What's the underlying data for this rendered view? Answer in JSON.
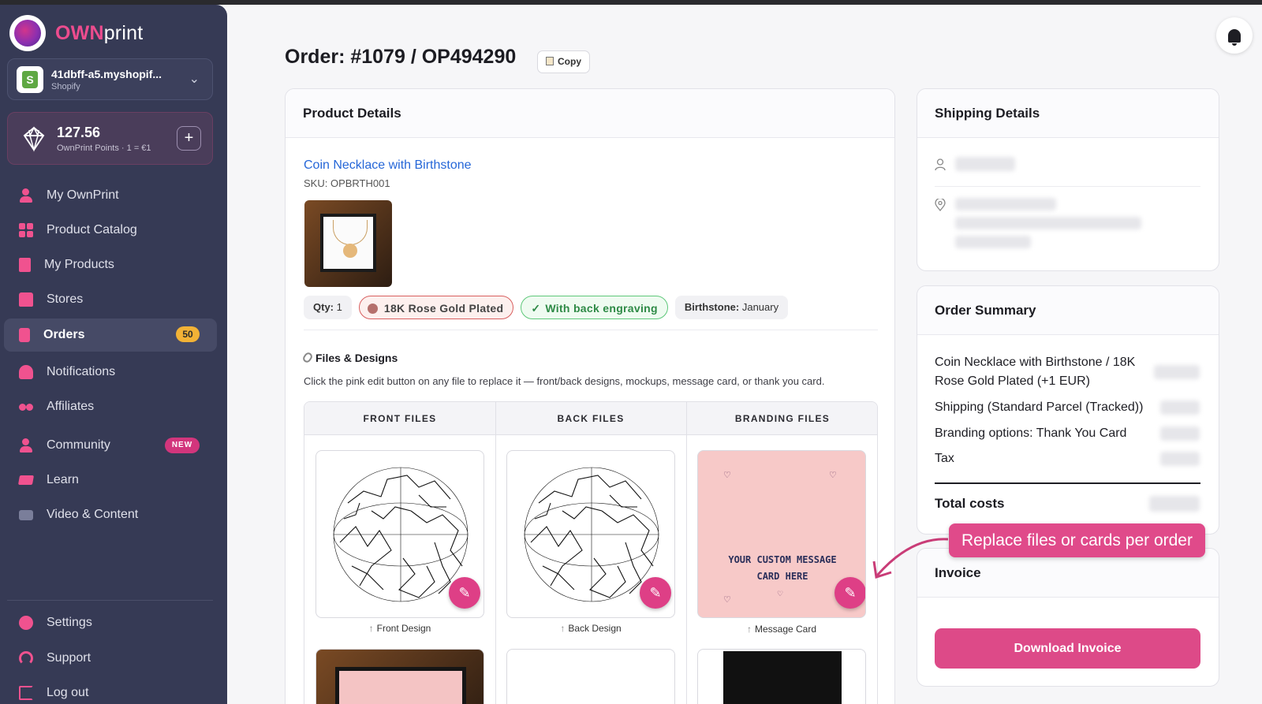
{
  "brand": {
    "own": "OWN",
    "print": "print"
  },
  "store": {
    "name": "41dbff-a5.myshopif...",
    "platform": "Shopify",
    "shop_icon_letter": "S"
  },
  "points": {
    "value": "127.56",
    "subtitle": "OwnPrint Points · 1 = €1",
    "add_label": "+"
  },
  "nav": {
    "my_ownprint": "My OwnPrint",
    "product_catalog": "Product Catalog",
    "my_products": "My Products",
    "stores": "Stores",
    "orders": "Orders",
    "orders_badge": "50",
    "notifications": "Notifications",
    "affiliates": "Affiliates",
    "community": "Community",
    "community_badge": "NEW",
    "learn": "Learn",
    "video_content": "Video & Content",
    "settings": "Settings",
    "support": "Support",
    "logout": "Log out"
  },
  "header": {
    "title": "Order: #1079 / OP494290",
    "copy_label": "Copy"
  },
  "product_details": {
    "heading": "Product Details",
    "product_name": "Coin Necklace with Birthstone",
    "sku": "SKU: OPBRTH001",
    "qty_label": "Qty:",
    "qty_value": "1",
    "material": "18K Rose Gold Plated",
    "engraving": "With back engraving",
    "birthstone_label": "Birthstone:",
    "birthstone_value": "January",
    "files_title": "Files & Designs",
    "files_desc": "Click the pink edit button on any file to replace it — front/back designs, mockups, message card, or thank you card.",
    "columns": [
      "FRONT FILES",
      "BACK FILES",
      "BRANDING FILES"
    ],
    "captions": {
      "front": "Front Design",
      "back": "Back Design",
      "message": "Message Card"
    },
    "message_card_text_1": "YOUR CUSTOM MESSAGE",
    "message_card_text_2": "CARD HERE"
  },
  "shipping": {
    "heading": "Shipping Details"
  },
  "order_summary": {
    "heading": "Order Summary",
    "line_1a": "Coin Necklace with Birthstone / 18K",
    "line_1b": "Rose Gold Plated (+1 EUR)",
    "line_2": "Shipping (Standard Parcel (Tracked))",
    "line_3": "Branding options: Thank You Card",
    "line_4": "Tax",
    "total_label": "Total costs"
  },
  "invoice": {
    "heading": "Invoice",
    "download_label": "Download Invoice"
  },
  "callout": {
    "text": "Replace files or cards per order"
  },
  "colors": {
    "accent": "#de3f86",
    "sidebar": "#363a55",
    "link": "#2667d8",
    "badge_orders": "#f2b236"
  }
}
